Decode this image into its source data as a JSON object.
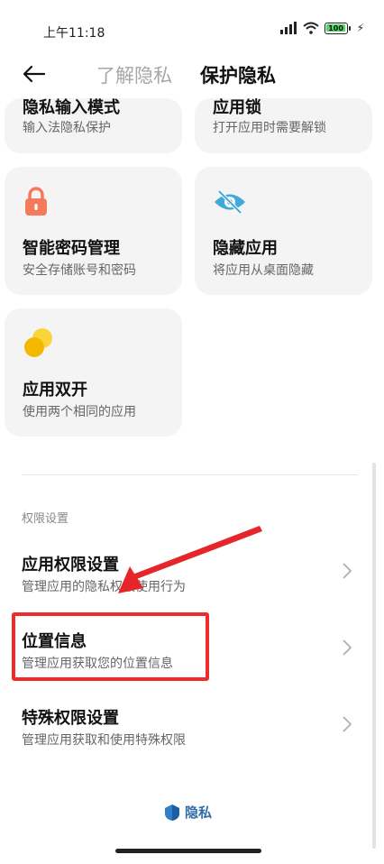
{
  "status_bar": {
    "time": "上午11:18",
    "battery": "100"
  },
  "header": {
    "tab_learn": "了解隐私",
    "tab_protect": "保护隐私"
  },
  "cards": [
    {
      "title": "隐私输入模式",
      "subtitle": "输入法隐私保护",
      "icon": "keyboard-icon"
    },
    {
      "title": "应用锁",
      "subtitle": "打开应用时需要解锁",
      "icon": "app-lock-icon"
    },
    {
      "title": "智能密码管理",
      "subtitle": "安全存储账号和密码",
      "icon": "padlock-icon",
      "icon_color": "#f37a5a"
    },
    {
      "title": "隐藏应用",
      "subtitle": "将应用从桌面隐藏",
      "icon": "eye-hidden-icon",
      "icon_color": "#3fa9dc"
    },
    {
      "title": "应用双开",
      "subtitle": "使用两个相同的应用",
      "icon": "dual-circles-icon",
      "icon_color": "#f5c518"
    }
  ],
  "section": {
    "label": "权限设置"
  },
  "list": [
    {
      "title": "应用权限设置",
      "subtitle": "管理应用的隐私权限使用行为"
    },
    {
      "title": "位置信息",
      "subtitle": "管理应用获取您的位置信息"
    },
    {
      "title": "特殊权限设置",
      "subtitle": "管理应用获取和使用特殊权限"
    }
  ],
  "footer": {
    "brand": "隐私"
  },
  "colors": {
    "highlight": "#ef2b2b",
    "brand": "#2f6ea8",
    "card_bg": "#f4f4f4"
  }
}
